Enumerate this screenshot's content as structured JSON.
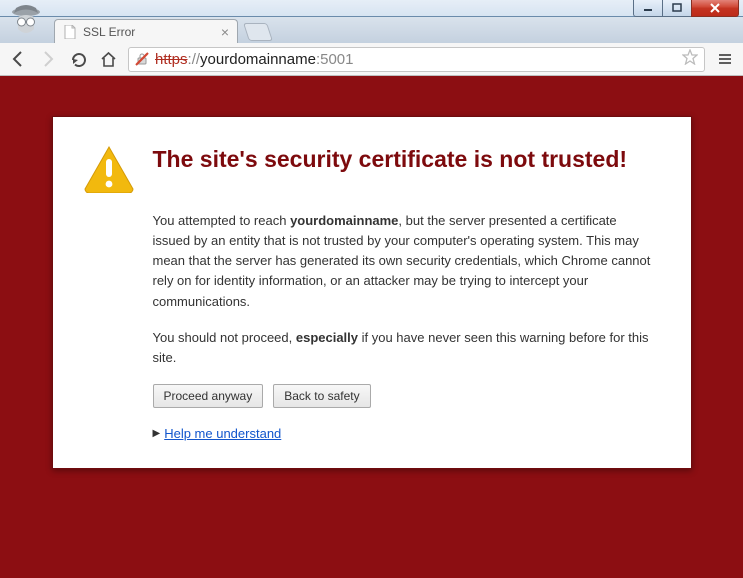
{
  "window": {
    "controls": {
      "min": "min",
      "max": "max",
      "close": "close"
    }
  },
  "tab": {
    "title": "SSL Error"
  },
  "toolbar": {
    "url_scheme": "https",
    "url_sep": "://",
    "url_host": "yourdomainname",
    "url_port": ":5001"
  },
  "page": {
    "title": "The site's security certificate is not trusted!",
    "para1_a": "You attempted to reach ",
    "para1_domain": "yourdomainname",
    "para1_b": ", but the server presented a certificate issued by an entity that is not trusted by your computer's operating system. This may mean that the server has generated its own security credentials, which Chrome cannot rely on for identity information, or an attacker may be trying to intercept your communications.",
    "para2_a": "You should not proceed, ",
    "para2_emph": "especially",
    "para2_b": " if you have never seen this warning before for this site.",
    "btn_proceed": "Proceed anyway",
    "btn_back": "Back to safety",
    "help_link": "Help me understand"
  }
}
